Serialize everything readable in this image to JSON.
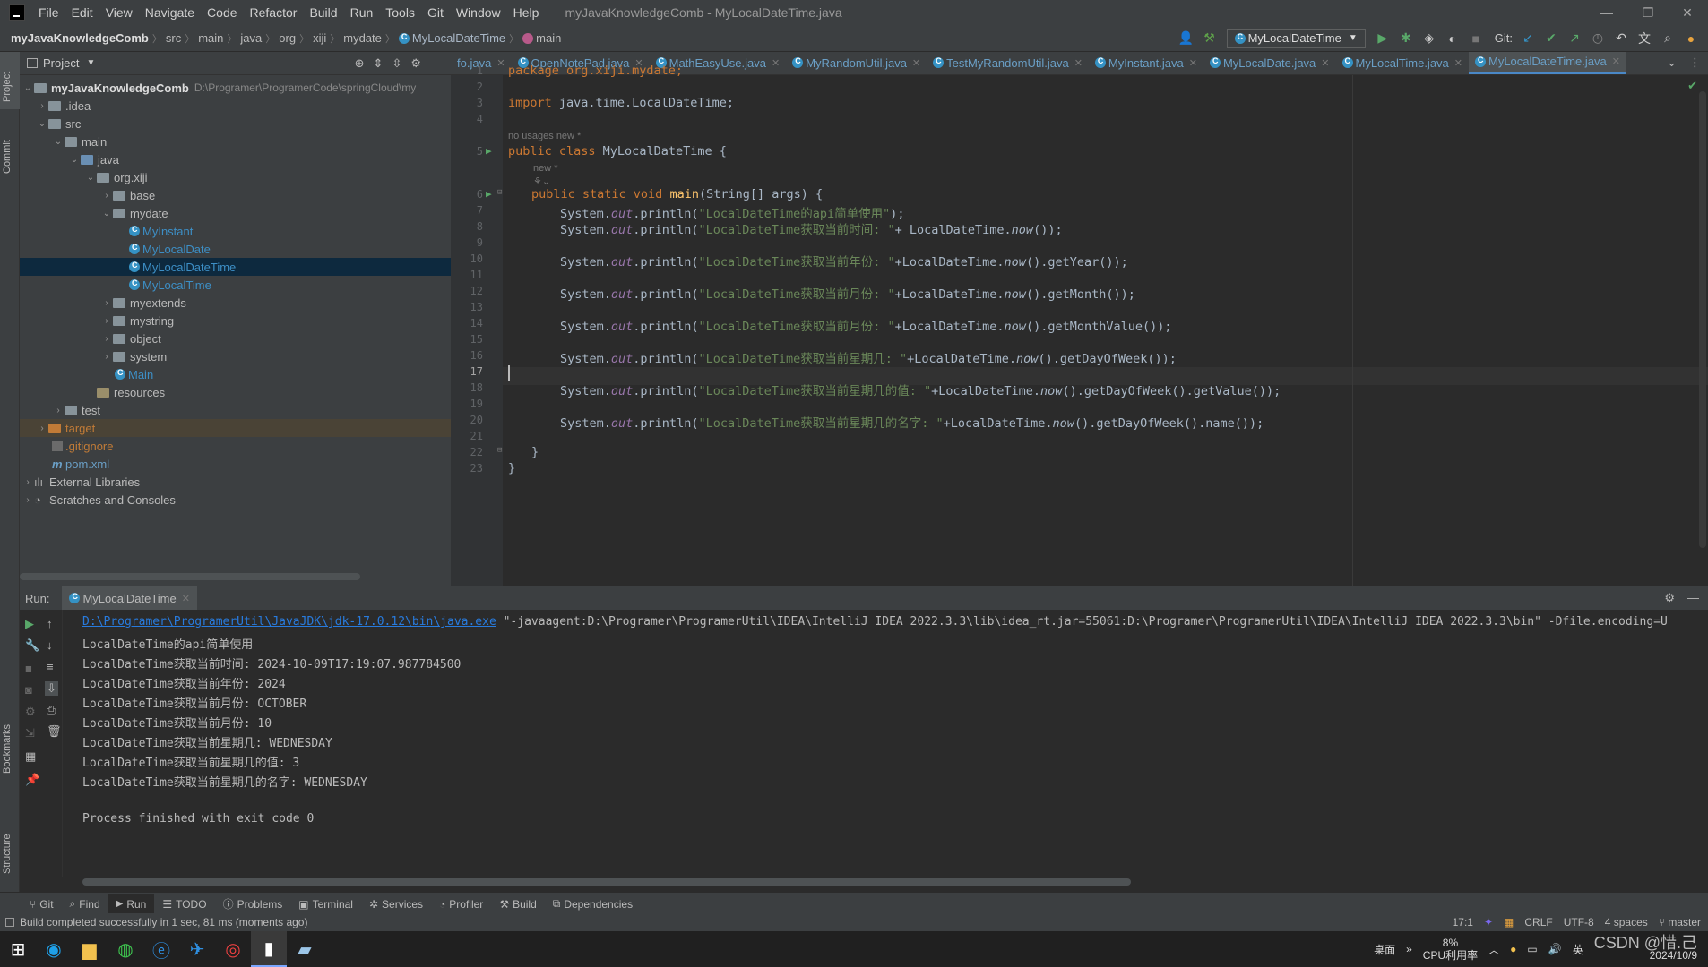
{
  "menubar": {
    "items": [
      "File",
      "Edit",
      "View",
      "Navigate",
      "Code",
      "Refactor",
      "Build",
      "Run",
      "Tools",
      "Git",
      "Window",
      "Help"
    ],
    "title": "myJavaKnowledgeComb - MyLocalDateTime.java"
  },
  "navbar": {
    "crumbs": [
      "myJavaKnowledgeComb",
      "src",
      "main",
      "java",
      "org",
      "xiji",
      "mydate",
      "MyLocalDateTime",
      "main"
    ],
    "run_config": "MyLocalDateTime",
    "git_label": "Git:"
  },
  "sidebar_labels": {
    "project": "Project",
    "commit": "Commit",
    "bookmarks": "Bookmarks",
    "structure": "Structure"
  },
  "project": {
    "title": "Project",
    "tree": [
      {
        "label": "myJavaKnowledgeComb",
        "extra": "D:\\Programer\\ProgramerCode\\springCloud\\my",
        "kind": "root"
      },
      {
        "label": ".idea",
        "kind": "folder"
      },
      {
        "label": "src",
        "kind": "folder"
      },
      {
        "label": "main",
        "kind": "folder"
      },
      {
        "label": "java",
        "kind": "src"
      },
      {
        "label": "org.xiji",
        "kind": "pkg"
      },
      {
        "label": "base",
        "kind": "pkg"
      },
      {
        "label": "mydate",
        "kind": "pkg"
      },
      {
        "label": "MyInstant",
        "kind": "class"
      },
      {
        "label": "MyLocalDate",
        "kind": "class"
      },
      {
        "label": "MyLocalDateTime",
        "kind": "class"
      },
      {
        "label": "MyLocalTime",
        "kind": "class"
      },
      {
        "label": "myextends",
        "kind": "pkg"
      },
      {
        "label": "mystring",
        "kind": "pkg"
      },
      {
        "label": "object",
        "kind": "pkg"
      },
      {
        "label": "system",
        "kind": "pkg"
      },
      {
        "label": "Main",
        "kind": "class"
      },
      {
        "label": "resources",
        "kind": "res"
      },
      {
        "label": "test",
        "kind": "folder"
      },
      {
        "label": "target",
        "kind": "orange"
      },
      {
        "label": ".gitignore",
        "kind": "file"
      },
      {
        "label": "pom.xml",
        "kind": "file"
      },
      {
        "label": "External Libraries",
        "kind": "lib"
      },
      {
        "label": "Scratches and Consoles",
        "kind": "lib"
      }
    ]
  },
  "tabs": [
    "fo.java",
    "OpenNotePad.java",
    "MathEasyUse.java",
    "MyRandomUtil.java",
    "TestMyRandomUtil.java",
    "MyInstant.java",
    "MyLocalDate.java",
    "MyLocalTime.java",
    "MyLocalDateTime.java"
  ],
  "editor": {
    "hint_usages": "no usages   new *",
    "hint_new": "new *",
    "lines": {
      "l1": "package org.xiji.mydate;",
      "l3_kw": "import",
      "l3_rest": " java.time.LocalDateTime;",
      "l5_kw": "public class",
      "l5_rest": " MyLocalDateTime {",
      "l6_kw": "public static void",
      "l6_mth": "main",
      "l6_rest": "(String[] args) {",
      "l7_str": "\"LocalDateTime的api简单使用\"",
      "l8_str": "\"LocalDateTime获取当前时间: \"",
      "l8_rest": "+ LocalDateTime.",
      "l10_str": "\"LocalDateTime获取当前年份: \"",
      "l12_str": "\"LocalDateTime获取当前月份: \"",
      "l14_str": "\"LocalDateTime获取当前月份: \"",
      "l16_str": "\"LocalDateTime获取当前星期几: \"",
      "l18_str": "\"LocalDateTime获取当前星期几的值: \"",
      "l20_str": "\"LocalDateTime获取当前星期几的名字: \"",
      "sys": "System.",
      "out": "out",
      "println": ".println(",
      "now": "now",
      "plus_ldt": "+LocalDateTime.",
      "close": ");",
      "tail8": "());",
      "tail10": "().getYear());",
      "tail12": "().getMonth());",
      "tail14": "().getMonthValue());",
      "tail16": "().getDayOfWeek());",
      "tail18": "().getDayOfWeek().getValue());",
      "tail20": "().getDayOfWeek().name());",
      "l22": "}",
      "l23": "}"
    }
  },
  "run": {
    "label": "Run:",
    "tab": "MyLocalDateTime",
    "cmd_link": "D:\\Programer\\ProgramerUtil\\JavaJDK\\jdk-17.0.12\\bin\\java.exe",
    "cmd_rest": " \"-javaagent:D:\\Programer\\ProgramerUtil\\IDEA\\IntelliJ IDEA 2022.3.3\\lib\\idea_rt.jar=55061:D:\\Programer\\ProgramerUtil\\IDEA\\IntelliJ IDEA 2022.3.3\\bin\" -Dfile.encoding=U",
    "output": [
      "LocalDateTime的api简单使用",
      "LocalDateTime获取当前时间: 2024-10-09T17:19:07.987784500",
      "LocalDateTime获取当前年份: 2024",
      "LocalDateTime获取当前月份: OCTOBER",
      "LocalDateTime获取当前月份: 10",
      "LocalDateTime获取当前星期几: WEDNESDAY",
      "LocalDateTime获取当前星期几的值: 3",
      "LocalDateTime获取当前星期几的名字: WEDNESDAY",
      "",
      "Process finished with exit code 0"
    ]
  },
  "bottom_tools": [
    "Git",
    "Find",
    "Run",
    "TODO",
    "Problems",
    "Terminal",
    "Services",
    "Profiler",
    "Build",
    "Dependencies"
  ],
  "status": {
    "message": "Build completed successfully in 1 sec, 81 ms (moments ago)",
    "position": "17:1",
    "line_sep": "CRLF",
    "encoding": "UTF-8",
    "indent": "4 spaces",
    "branch": "master"
  },
  "taskbar": {
    "desktop": "桌面",
    "cpu_pct": "8%",
    "cpu_label": "CPU利用率",
    "ime": "英",
    "date": "2024/10/9",
    "watermark": "CSDN @惜.己"
  },
  "colors": {
    "keyword": "#cc7832",
    "string": "#6a8759",
    "field": "#9876aa",
    "method": "#ffc66d",
    "selection": "#0d293e",
    "accent": "#4a88c7"
  }
}
